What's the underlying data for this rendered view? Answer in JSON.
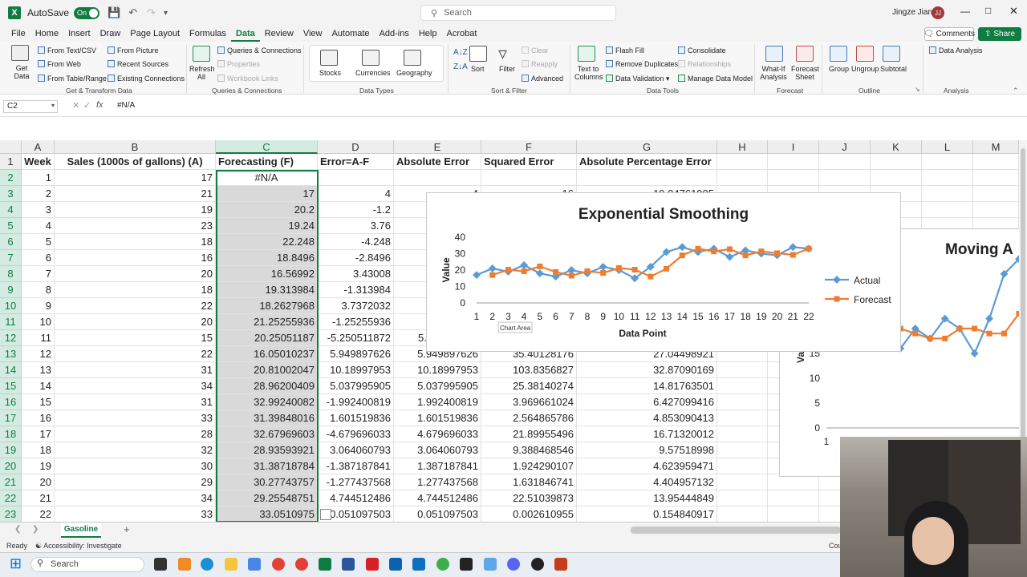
{
  "titlebar": {
    "autosave_label": "AutoSave",
    "autosave_state": "On",
    "search_placeholder": "Search",
    "user_name": "Jingze Jiang",
    "user_initials": "JJ"
  },
  "menu": {
    "tabs": [
      "File",
      "Home",
      "Insert",
      "Draw",
      "Page Layout",
      "Formulas",
      "Data",
      "Review",
      "View",
      "Automate",
      "Add-ins",
      "Help",
      "Acrobat"
    ],
    "active": "Data",
    "comments_label": "Comments",
    "share_label": "Share"
  },
  "ribbon": {
    "get_data": "Get Data",
    "from_text_csv": "From Text/CSV",
    "from_web": "From Web",
    "from_table_range": "From Table/Range",
    "from_picture": "From Picture",
    "recent_sources": "Recent Sources",
    "existing_connections": "Existing Connections",
    "group_get_transform": "Get & Transform Data",
    "refresh_all": "Refresh All",
    "queries_connections": "Queries & Connections",
    "properties": "Properties",
    "workbook_links": "Workbook Links",
    "group_queries": "Queries & Connections",
    "stocks": "Stocks",
    "currencies": "Currencies",
    "geography": "Geography",
    "group_data_types": "Data Types",
    "sort": "Sort",
    "filter": "Filter",
    "clear": "Clear",
    "reapply": "Reapply",
    "advanced": "Advanced",
    "group_sort_filter": "Sort & Filter",
    "text_to_columns": "Text to Columns",
    "flash_fill": "Flash Fill",
    "remove_duplicates": "Remove Duplicates",
    "data_validation": "Data Validation",
    "consolidate": "Consolidate",
    "relationships": "Relationships",
    "manage_data_model": "Manage Data Model",
    "group_data_tools": "Data Tools",
    "what_if": "What-If Analysis",
    "forecast_sheet": "Forecast Sheet",
    "group_forecast": "Forecast",
    "group_btn": "Group",
    "ungroup": "Ungroup",
    "subtotal": "Subtotal",
    "group_outline": "Outline",
    "data_analysis": "Data Analysis",
    "group_analysis": "Analysis"
  },
  "formula_bar": {
    "name_box": "C2",
    "fx": "fx",
    "value": "#N/A"
  },
  "columns": [
    "A",
    "B",
    "C",
    "D",
    "E",
    "F",
    "G",
    "H",
    "I",
    "J",
    "K",
    "L",
    "M"
  ],
  "headers": {
    "a": "Week",
    "b": "Sales (1000s of gallons) (A)",
    "c": "Forecasting (F)",
    "d": "Error=A-F",
    "e": "Absolute Error",
    "f": "Squared Error",
    "g": "Absolute Percentage Error"
  },
  "rows": [
    {
      "n": "2",
      "a": "1",
      "b": "17",
      "c": "#N/A",
      "d": "",
      "e": "",
      "f": "",
      "g": ""
    },
    {
      "n": "3",
      "a": "2",
      "b": "21",
      "c": "17",
      "d": "4",
      "e": "4",
      "f": "16",
      "g": "19.04761905"
    },
    {
      "n": "4",
      "a": "3",
      "b": "19",
      "c": "20.2",
      "d": "-1.2",
      "e": "",
      "f": "",
      "g": ""
    },
    {
      "n": "5",
      "a": "4",
      "b": "23",
      "c": "19.24",
      "d": "3.76",
      "e": "",
      "f": "",
      "g": ""
    },
    {
      "n": "6",
      "a": "5",
      "b": "18",
      "c": "22.248",
      "d": "-4.248",
      "e": "",
      "f": "",
      "g": ""
    },
    {
      "n": "7",
      "a": "6",
      "b": "16",
      "c": "18.8496",
      "d": "-2.8496",
      "e": "",
      "f": "",
      "g": ""
    },
    {
      "n": "8",
      "a": "7",
      "b": "20",
      "c": "16.56992",
      "d": "3.43008",
      "e": "",
      "f": "",
      "g": ""
    },
    {
      "n": "9",
      "a": "8",
      "b": "18",
      "c": "19.313984",
      "d": "-1.313984",
      "e": "",
      "f": "",
      "g": ""
    },
    {
      "n": "10",
      "a": "9",
      "b": "22",
      "c": "18.2627968",
      "d": "3.7372032",
      "e": "",
      "f": "",
      "g": ""
    },
    {
      "n": "11",
      "a": "10",
      "b": "20",
      "c": "21.25255936",
      "d": "-1.25255936",
      "e": "",
      "f": "",
      "g": ""
    },
    {
      "n": "12",
      "a": "11",
      "b": "15",
      "c": "20.25051187",
      "d": "-5.250511872",
      "e": "5.250511872",
      "f": "",
      "g": ""
    },
    {
      "n": "13",
      "a": "12",
      "b": "22",
      "c": "16.05010237",
      "d": "5.949897626",
      "e": "5.949897626",
      "f": "35.40128176",
      "g": "27.04498921"
    },
    {
      "n": "14",
      "a": "13",
      "b": "31",
      "c": "20.81002047",
      "d": "10.18997953",
      "e": "10.18997953",
      "f": "103.8356827",
      "g": "32.87090169"
    },
    {
      "n": "15",
      "a": "14",
      "b": "34",
      "c": "28.96200409",
      "d": "5.037995905",
      "e": "5.037995905",
      "f": "25.38140274",
      "g": "14.81763501"
    },
    {
      "n": "16",
      "a": "15",
      "b": "31",
      "c": "32.99240082",
      "d": "-1.992400819",
      "e": "1.992400819",
      "f": "3.969661024",
      "g": "6.427099416"
    },
    {
      "n": "17",
      "a": "16",
      "b": "33",
      "c": "31.39848016",
      "d": "1.601519836",
      "e": "1.601519836",
      "f": "2.564865786",
      "g": "4.853090413"
    },
    {
      "n": "18",
      "a": "17",
      "b": "28",
      "c": "32.67969603",
      "d": "-4.679696033",
      "e": "4.679696033",
      "f": "21.89955496",
      "g": "16.71320012"
    },
    {
      "n": "19",
      "a": "18",
      "b": "32",
      "c": "28.93593921",
      "d": "3.064060793",
      "e": "3.064060793",
      "f": "9.388468546",
      "g": "9.57518998"
    },
    {
      "n": "20",
      "a": "19",
      "b": "30",
      "c": "31.38718784",
      "d": "-1.387187841",
      "e": "1.387187841",
      "f": "1.924290107",
      "g": "4.623959471"
    },
    {
      "n": "21",
      "a": "20",
      "b": "29",
      "c": "30.27743757",
      "d": "-1.277437568",
      "e": "1.277437568",
      "f": "1.631846741",
      "g": "4.404957132"
    },
    {
      "n": "22",
      "a": "21",
      "b": "34",
      "c": "29.25548751",
      "d": "4.744512486",
      "e": "4.744512486",
      "f": "22.51039873",
      "g": "13.95444849"
    },
    {
      "n": "23",
      "a": "22",
      "b": "33",
      "c": "33.0510975",
      "d": "0.051097503",
      "e": "0.051097503",
      "f": "0.002610955",
      "g": "0.154840917"
    }
  ],
  "chart_data": [
    {
      "type": "line",
      "title": "Exponential Smoothing",
      "xlabel": "Data Point",
      "ylabel": "Value",
      "x": [
        1,
        2,
        3,
        4,
        5,
        6,
        7,
        8,
        9,
        10,
        11,
        12,
        13,
        14,
        15,
        16,
        17,
        18,
        19,
        20,
        21,
        22
      ],
      "ylim": [
        0,
        40
      ],
      "yticks": [
        0,
        10,
        20,
        30,
        40
      ],
      "legend": "right",
      "series": [
        {
          "name": "Actual",
          "color": "#5b9bd5",
          "values": [
            17,
            21,
            19,
            23,
            18,
            16,
            20,
            18,
            22,
            20,
            15,
            22,
            31,
            34,
            31,
            33,
            28,
            32,
            30,
            29,
            34,
            33
          ]
        },
        {
          "name": "Forecast",
          "color": "#ed7d31",
          "values": [
            null,
            17,
            20.2,
            19.24,
            22.248,
            18.8496,
            16.56992,
            19.313984,
            18.2627968,
            21.25255936,
            20.25051187,
            16.05010237,
            20.81002047,
            28.96200409,
            32.99240082,
            31.39848016,
            32.67969603,
            28.93593921,
            31.38718784,
            30.27743757,
            29.25548751,
            33.0510975
          ]
        }
      ],
      "tooltip": "Chart Area"
    },
    {
      "type": "line",
      "title": "Moving A",
      "ylabel": "Va",
      "yticks": [
        0,
        5,
        10,
        15
      ],
      "x_first_tick": "1",
      "ylim": [
        0,
        40
      ],
      "series": [
        {
          "name": "Actual",
          "color": "#5b9bd5",
          "values": [
            17,
            21,
            19,
            23,
            18,
            16,
            20,
            18,
            22,
            20,
            15,
            22,
            31,
            34
          ]
        },
        {
          "name": "Forecast",
          "color": "#ed7d31",
          "values": [
            null,
            null,
            null,
            19,
            21,
            20,
            19,
            18,
            18,
            20,
            20,
            19,
            19,
            23
          ]
        }
      ]
    }
  ],
  "sheet": {
    "tab": "Gasoline",
    "add": "+"
  },
  "status": {
    "ready": "Ready",
    "accessibility": "Accessibility: Investigate",
    "right": "Cou"
  },
  "taskbar": {
    "search": "Search"
  }
}
